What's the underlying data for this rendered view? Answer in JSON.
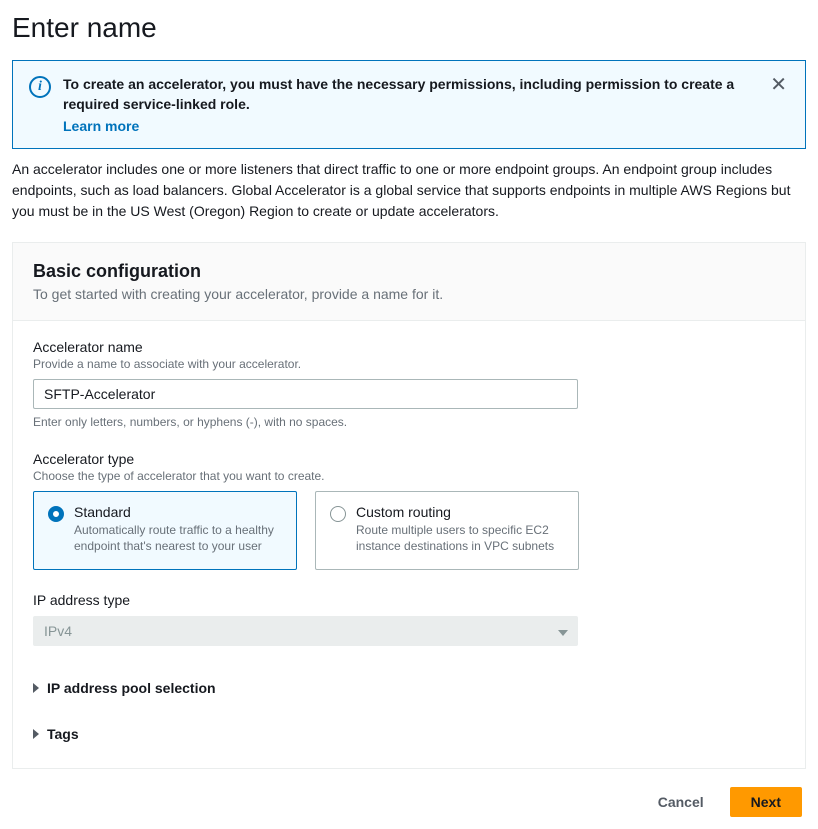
{
  "page": {
    "title": "Enter name"
  },
  "alert": {
    "icon_glyph": "i",
    "text": "To create an accelerator, you must have the necessary permissions, including permission to create a required service-linked role.",
    "learn_more": "Learn more"
  },
  "intro": "An accelerator includes one or more listeners that direct traffic to one or more endpoint groups. An endpoint group includes endpoints, such as load balancers. Global Accelerator is a global service that supports endpoints in multiple AWS Regions but you must be in the US West (Oregon) Region to create or update accelerators.",
  "panel": {
    "title": "Basic configuration",
    "subtitle": "To get started with creating your accelerator, provide a name for it."
  },
  "fields": {
    "name": {
      "label": "Accelerator name",
      "help": "Provide a name to associate with your accelerator.",
      "value": "SFTP-Accelerator",
      "hint": "Enter only letters, numbers, or hyphens (-), with no spaces."
    },
    "type": {
      "label": "Accelerator type",
      "help": "Choose the type of accelerator that you want to create.",
      "options": {
        "standard": {
          "title": "Standard",
          "desc": "Automatically route traffic to a healthy endpoint that's nearest to your user"
        },
        "custom": {
          "title": "Custom routing",
          "desc": "Route multiple users to specific EC2 instance destinations in VPC subnets"
        }
      },
      "selected": "standard"
    },
    "ip_type": {
      "label": "IP address type",
      "value": "IPv4"
    },
    "pool_selection": {
      "label": "IP address pool selection"
    },
    "tags": {
      "label": "Tags"
    }
  },
  "buttons": {
    "cancel": "Cancel",
    "next": "Next"
  }
}
